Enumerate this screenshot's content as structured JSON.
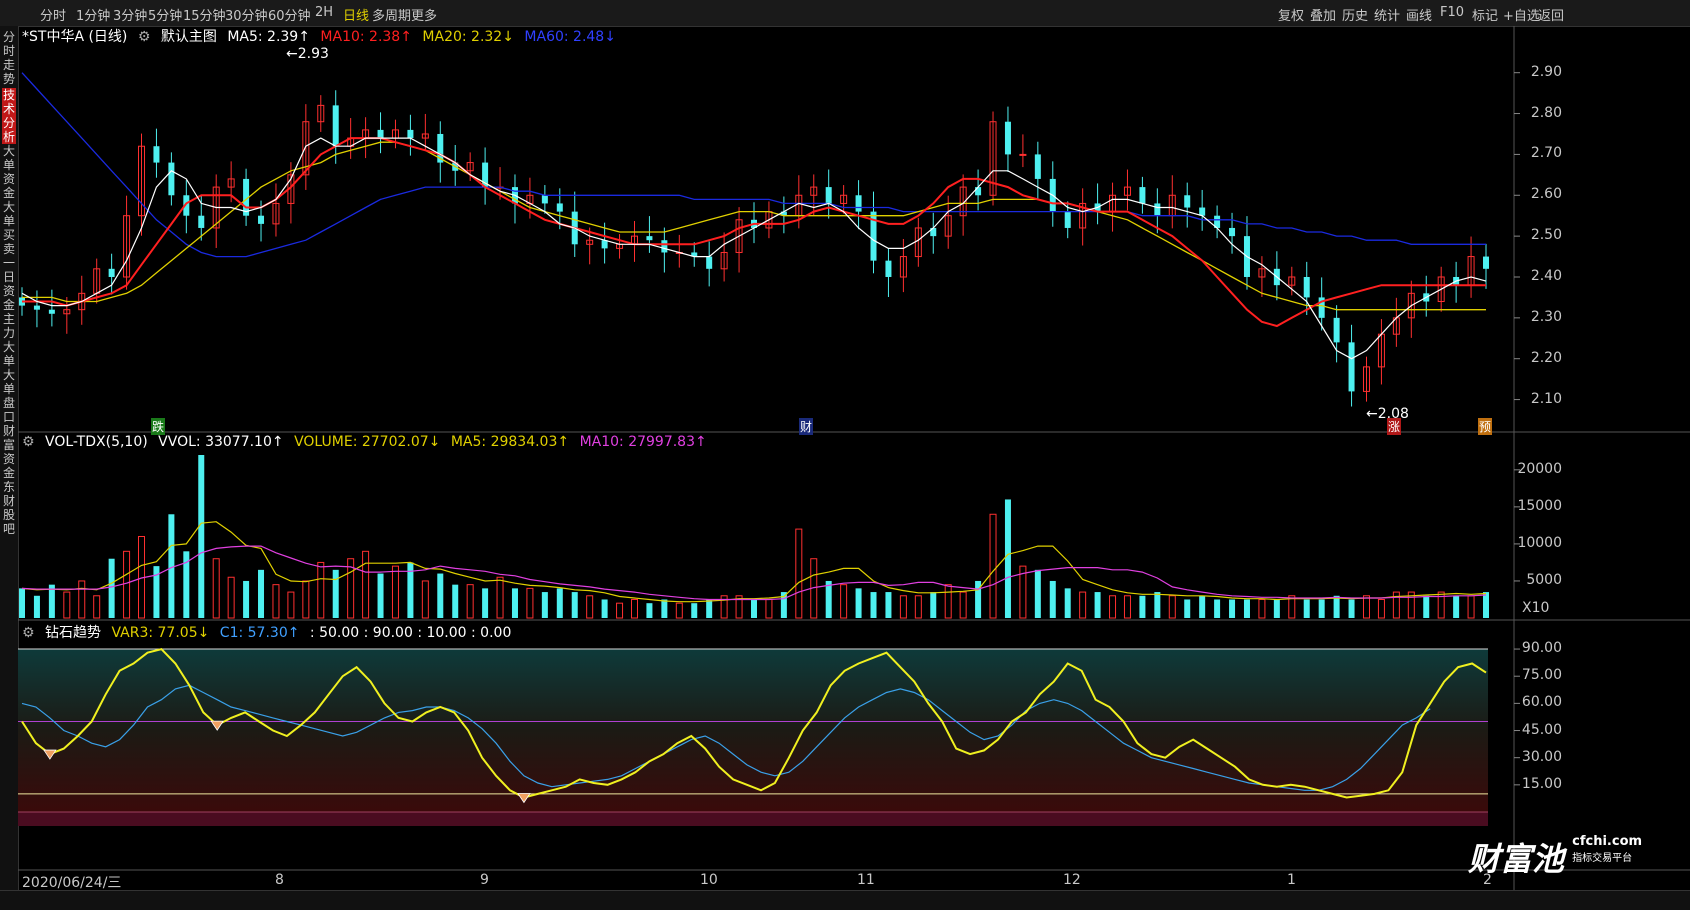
{
  "toolbar": {
    "left_tabs": [
      {
        "label": "分时",
        "active": false
      },
      {
        "label": "1分钟",
        "active": false
      },
      {
        "label": "3分钟",
        "active": false
      },
      {
        "label": "5分钟",
        "active": false
      },
      {
        "label": "15分钟",
        "active": false
      },
      {
        "label": "30分钟",
        "active": false
      },
      {
        "label": "60分钟",
        "active": false
      },
      {
        "label": "2H",
        "active": false
      },
      {
        "label": "日线",
        "active": true
      },
      {
        "label": "多周期",
        "active": false
      },
      {
        "label": "更多",
        "active": false
      }
    ],
    "right_tabs": [
      "复权",
      "叠加",
      "历史",
      "统计",
      "画线",
      "F10",
      "标记",
      "+自选",
      "返回"
    ]
  },
  "side_tabs": [
    {
      "label": "分时走势",
      "active": false
    },
    {
      "label": "技术分析",
      "active": true
    },
    {
      "label": "大单资金",
      "active": false
    },
    {
      "label": "大单买卖",
      "active": false
    },
    {
      "label": "一日资金",
      "active": false
    },
    {
      "label": "主力大单",
      "active": false
    },
    {
      "label": "大单盘口",
      "active": false
    },
    {
      "label": "财富资金",
      "active": false
    },
    {
      "label": "东财股吧",
      "active": false
    }
  ],
  "main_panel": {
    "title": "*ST中华A (日线)",
    "template": "默认主图",
    "ma5": "MA5: 2.39↑",
    "ma10": "MA10: 2.38↑",
    "ma20": "MA20: 2.32↓",
    "ma60": "MA60: 2.48↓",
    "high_label": "2.93",
    "low_label": "2.08",
    "markers": {
      "die": "跌",
      "cai": "财",
      "zhang": "涨",
      "yu": "预"
    },
    "colors": {
      "ma5": "#ffffff",
      "ma10": "#ff2020",
      "ma20": "#e0d000",
      "ma60": "#1a2adf",
      "up": "#ff3030",
      "down": "#4ef0f0"
    }
  },
  "vol_panel": {
    "title": "VOL-TDX(5,10)",
    "vvol": "VVOL: 33077.10↑",
    "volume": "VOLUME: 27702.07↓",
    "ma5": "MA5: 29834.03↑",
    "ma10": "MA10: 27997.83↑",
    "unit": "X10"
  },
  "diamond_panel": {
    "title": "钻石趋势",
    "var3": "VAR3: 77.05↓",
    "c1": "C1: 57.30↑",
    "levels": ": 50.00 : 90.00 : 10.00 : 0.00"
  },
  "watermark": {
    "brand": "财富池",
    "site": "cfchi.com",
    "tagline": "指标交易平台"
  },
  "chart_data": [
    {
      "type": "candlestick",
      "title": "*ST中华A (日线)",
      "ylim": [
        2.05,
        2.98
      ],
      "yticks": [
        "2.90",
        "2.80",
        "2.70",
        "2.60",
        "2.50",
        "2.40",
        "2.30",
        "2.20",
        "2.10"
      ],
      "x_labels": [
        "2020/06/24/三",
        "8",
        "9",
        "10",
        "11",
        "12",
        "1",
        "2"
      ],
      "close": [
        2.33,
        2.32,
        2.31,
        2.32,
        2.36,
        2.42,
        2.4,
        2.55,
        2.72,
        2.68,
        2.6,
        2.55,
        2.52,
        2.62,
        2.64,
        2.55,
        2.53,
        2.58,
        2.65,
        2.78,
        2.82,
        2.72,
        2.74,
        2.76,
        2.74,
        2.76,
        2.74,
        2.75,
        2.68,
        2.66,
        2.68,
        2.62,
        2.62,
        2.58,
        2.6,
        2.58,
        2.56,
        2.48,
        2.49,
        2.47,
        2.48,
        2.5,
        2.49,
        2.46,
        2.46,
        2.45,
        2.42,
        2.46,
        2.54,
        2.52,
        2.56,
        2.55,
        2.6,
        2.62,
        2.58,
        2.6,
        2.56,
        2.44,
        2.4,
        2.45,
        2.52,
        2.5,
        2.55,
        2.62,
        2.6,
        2.78,
        2.7,
        2.7,
        2.64,
        2.56,
        2.52,
        2.58,
        2.56,
        2.6,
        2.62,
        2.58,
        2.55,
        2.6,
        2.57,
        2.55,
        2.52,
        2.5,
        2.4,
        2.42,
        2.38,
        2.4,
        2.35,
        2.3,
        2.24,
        2.12,
        2.18,
        2.26,
        2.3,
        2.36,
        2.34,
        2.4,
        2.38,
        2.45,
        2.42
      ],
      "ma5": [
        2.36,
        2.34,
        2.33,
        2.33,
        2.34,
        2.36,
        2.38,
        2.44,
        2.52,
        2.62,
        2.66,
        2.64,
        2.58,
        2.57,
        2.57,
        2.56,
        2.57,
        2.59,
        2.64,
        2.72,
        2.74,
        2.72,
        2.72,
        2.74,
        2.74,
        2.74,
        2.74,
        2.72,
        2.7,
        2.68,
        2.65,
        2.63,
        2.61,
        2.6,
        2.58,
        2.56,
        2.53,
        2.52,
        2.5,
        2.49,
        2.48,
        2.48,
        2.48,
        2.47,
        2.46,
        2.45,
        2.45,
        2.48,
        2.5,
        2.52,
        2.54,
        2.56,
        2.58,
        2.57,
        2.58,
        2.56,
        2.52,
        2.49,
        2.47,
        2.47,
        2.49,
        2.52,
        2.56,
        2.58,
        2.62,
        2.66,
        2.66,
        2.64,
        2.62,
        2.6,
        2.57,
        2.56,
        2.57,
        2.59,
        2.59,
        2.58,
        2.57,
        2.57,
        2.56,
        2.55,
        2.52,
        2.48,
        2.45,
        2.43,
        2.4,
        2.37,
        2.34,
        2.28,
        2.22,
        2.2,
        2.22,
        2.26,
        2.3,
        2.33,
        2.35,
        2.37,
        2.39,
        2.4,
        2.39
      ],
      "ma10": [
        2.34,
        2.34,
        2.34,
        2.33,
        2.34,
        2.35,
        2.36,
        2.38,
        2.43,
        2.48,
        2.53,
        2.58,
        2.6,
        2.6,
        2.6,
        2.57,
        2.57,
        2.59,
        2.62,
        2.66,
        2.7,
        2.72,
        2.74,
        2.74,
        2.74,
        2.73,
        2.72,
        2.71,
        2.7,
        2.68,
        2.65,
        2.62,
        2.6,
        2.58,
        2.56,
        2.54,
        2.53,
        2.52,
        2.51,
        2.5,
        2.49,
        2.48,
        2.48,
        2.48,
        2.48,
        2.48,
        2.49,
        2.5,
        2.52,
        2.53,
        2.53,
        2.53,
        2.54,
        2.56,
        2.57,
        2.56,
        2.55,
        2.54,
        2.53,
        2.53,
        2.55,
        2.58,
        2.62,
        2.64,
        2.64,
        2.63,
        2.62,
        2.6,
        2.59,
        2.58,
        2.58,
        2.57,
        2.56,
        2.56,
        2.56,
        2.54,
        2.52,
        2.5,
        2.47,
        2.44,
        2.4,
        2.36,
        2.32,
        2.29,
        2.28,
        2.3,
        2.32,
        2.34,
        2.35,
        2.36,
        2.37,
        2.38,
        2.38,
        2.38,
        2.38,
        2.38,
        2.38,
        2.38,
        2.38
      ],
      "ma20": [
        2.35,
        2.35,
        2.35,
        2.34,
        2.34,
        2.34,
        2.35,
        2.36,
        2.38,
        2.41,
        2.44,
        2.47,
        2.5,
        2.53,
        2.56,
        2.59,
        2.62,
        2.64,
        2.66,
        2.67,
        2.68,
        2.7,
        2.71,
        2.72,
        2.73,
        2.73,
        2.72,
        2.71,
        2.69,
        2.67,
        2.65,
        2.63,
        2.61,
        2.59,
        2.57,
        2.56,
        2.55,
        2.54,
        2.53,
        2.52,
        2.51,
        2.51,
        2.51,
        2.51,
        2.52,
        2.53,
        2.54,
        2.55,
        2.56,
        2.56,
        2.56,
        2.55,
        2.55,
        2.55,
        2.55,
        2.55,
        2.55,
        2.55,
        2.55,
        2.55,
        2.56,
        2.57,
        2.58,
        2.58,
        2.58,
        2.59,
        2.59,
        2.59,
        2.59,
        2.58,
        2.58,
        2.57,
        2.56,
        2.55,
        2.54,
        2.52,
        2.5,
        2.48,
        2.46,
        2.44,
        2.42,
        2.4,
        2.38,
        2.36,
        2.35,
        2.34,
        2.33,
        2.33,
        2.32,
        2.32,
        2.32,
        2.32,
        2.32,
        2.32,
        2.32,
        2.32,
        2.32,
        2.32,
        2.32
      ],
      "ma60": [
        2.9,
        2.86,
        2.82,
        2.78,
        2.74,
        2.7,
        2.66,
        2.62,
        2.58,
        2.54,
        2.51,
        2.48,
        2.46,
        2.45,
        2.45,
        2.45,
        2.46,
        2.47,
        2.48,
        2.49,
        2.51,
        2.53,
        2.55,
        2.57,
        2.59,
        2.6,
        2.61,
        2.62,
        2.62,
        2.62,
        2.62,
        2.62,
        2.62,
        2.61,
        2.61,
        2.6,
        2.6,
        2.6,
        2.6,
        2.6,
        2.6,
        2.6,
        2.6,
        2.6,
        2.6,
        2.59,
        2.59,
        2.59,
        2.59,
        2.59,
        2.59,
        2.58,
        2.58,
        2.58,
        2.58,
        2.57,
        2.57,
        2.57,
        2.57,
        2.56,
        2.56,
        2.56,
        2.56,
        2.56,
        2.56,
        2.56,
        2.56,
        2.56,
        2.56,
        2.56,
        2.56,
        2.56,
        2.56,
        2.56,
        2.56,
        2.55,
        2.55,
        2.55,
        2.55,
        2.54,
        2.54,
        2.54,
        2.53,
        2.53,
        2.52,
        2.52,
        2.51,
        2.51,
        2.5,
        2.5,
        2.49,
        2.49,
        2.49,
        2.48,
        2.48,
        2.48,
        2.48,
        2.48,
        2.48
      ]
    },
    {
      "type": "bar",
      "title": "VOL-TDX(5,10)",
      "ylim": [
        0,
        22000
      ],
      "yticks": [
        "20000",
        "15000",
        "10000",
        "5000"
      ],
      "values": [
        4000,
        3000,
        4500,
        3500,
        5000,
        3000,
        8000,
        9000,
        11000,
        7000,
        14000,
        9000,
        22000,
        8000,
        5500,
        5000,
        6500,
        4500,
        3500,
        5000,
        7500,
        6500,
        8000,
        9000,
        6000,
        7000,
        7500,
        5000,
        6000,
        4500,
        4500,
        4000,
        5500,
        4000,
        4000,
        3500,
        4000,
        3500,
        3000,
        2500,
        2000,
        2500,
        2000,
        2500,
        2000,
        2000,
        2500,
        3000,
        3000,
        2500,
        2500,
        3500,
        12000,
        8000,
        5000,
        4500,
        4000,
        3500,
        3500,
        3000,
        3000,
        3500,
        4500,
        3500,
        5000,
        14000,
        16000,
        7000,
        6500,
        5000,
        4000,
        3500,
        3500,
        3000,
        3000,
        3000,
        3500,
        3000,
        2500,
        3000,
        2500,
        2500,
        2500,
        2500,
        2500,
        3000,
        2500,
        2500,
        3000,
        2500,
        3000,
        2500,
        3500,
        3500,
        3000,
        3500,
        3000,
        3000,
        3500
      ],
      "ma5": [
        4000,
        3800,
        3900,
        3800,
        4000,
        3800,
        4700,
        5900,
        7100,
        7600,
        9800,
        10000,
        12800,
        13000,
        11600,
        9800,
        9400,
        5900,
        5000,
        4900,
        5300,
        5200,
        6200,
        7400,
        7400,
        7400,
        7500,
        6700,
        6600,
        6000,
        5500,
        5000,
        5100,
        4700,
        4400,
        4300,
        4100,
        3800,
        3700,
        3400,
        2900,
        2700,
        2500,
        2300,
        2200,
        2200,
        2300,
        2400,
        2600,
        2600,
        2700,
        2900,
        4800,
        5800,
        6200,
        6700,
        6700,
        5000,
        4100,
        3700,
        3400,
        3400,
        3500,
        3600,
        3800,
        6300,
        8600,
        9100,
        9700,
        9700,
        7700,
        5200,
        4500,
        3800,
        3400,
        3200,
        3200,
        3100,
        3000,
        3000,
        2900,
        2700,
        2600,
        2600,
        2500,
        2600,
        2600,
        2600,
        2700,
        2600,
        2700,
        2700,
        2900,
        3000,
        3100,
        3200,
        3300,
        3200,
        3300
      ],
      "ma10": [
        4000,
        3900,
        3900,
        3900,
        3900,
        3900,
        4200,
        4700,
        5400,
        5800,
        6800,
        7500,
        8800,
        9400,
        9600,
        9700,
        9700,
        8800,
        8100,
        7400,
        6900,
        7000,
        6900,
        6200,
        6200,
        6300,
        6300,
        6500,
        7000,
        6700,
        6500,
        6300,
        5900,
        5700,
        5200,
        4900,
        4600,
        4400,
        4200,
        3900,
        3700,
        3500,
        3200,
        3000,
        2800,
        2600,
        2500,
        2500,
        2500,
        2500,
        2500,
        2600,
        3500,
        4100,
        4400,
        4700,
        4800,
        4800,
        4400,
        4500,
        4800,
        4800,
        4300,
        4100,
        3900,
        4500,
        5500,
        6000,
        6400,
        6600,
        6800,
        6800,
        6800,
        6500,
        6500,
        6200,
        5400,
        4200,
        3800,
        3500,
        3200,
        3000,
        2900,
        2800,
        2800,
        2700,
        2700,
        2700,
        2800,
        2700,
        2700,
        2700,
        2800,
        2800,
        2900,
        2900,
        3000,
        3000,
        3100
      ]
    },
    {
      "type": "line",
      "title": "钻石趋势",
      "ylim": [
        0,
        95
      ],
      "yticks": [
        "90.00",
        "75.00",
        "60.00",
        "45.00",
        "30.00",
        "15.00"
      ],
      "reference_lines": [
        90,
        50,
        10,
        0
      ],
      "var3": [
        50,
        38,
        32,
        35,
        42,
        50,
        65,
        78,
        82,
        88,
        90,
        82,
        70,
        55,
        48,
        52,
        55,
        50,
        45,
        42,
        48,
        55,
        65,
        75,
        80,
        72,
        60,
        52,
        50,
        55,
        58,
        55,
        45,
        30,
        20,
        12,
        8,
        10,
        12,
        14,
        18,
        16,
        15,
        18,
        22,
        28,
        32,
        38,
        42,
        35,
        25,
        18,
        15,
        12,
        16,
        30,
        45,
        55,
        70,
        78,
        82,
        85,
        88,
        80,
        72,
        60,
        50,
        35,
        32,
        34,
        40,
        50,
        55,
        65,
        72,
        82,
        78,
        62,
        58,
        50,
        38,
        32,
        30,
        36,
        40,
        35,
        30,
        25,
        18,
        15,
        14,
        15,
        14,
        12,
        10,
        8,
        9,
        10,
        12,
        22,
        48,
        60,
        72,
        80,
        82,
        77
      ],
      "c1": [
        60,
        58,
        52,
        45,
        42,
        38,
        36,
        40,
        48,
        58,
        62,
        68,
        70,
        66,
        62,
        58,
        56,
        54,
        52,
        50,
        48,
        46,
        44,
        42,
        44,
        48,
        52,
        55,
        56,
        58,
        58,
        56,
        52,
        46,
        38,
        28,
        20,
        16,
        14,
        15,
        16,
        17,
        18,
        20,
        24,
        28,
        32,
        36,
        40,
        42,
        38,
        32,
        26,
        22,
        20,
        22,
        28,
        36,
        44,
        52,
        58,
        62,
        66,
        68,
        66,
        62,
        56,
        50,
        44,
        40,
        42,
        48,
        56,
        60,
        62,
        60,
        56,
        50,
        44,
        38,
        34,
        30,
        28,
        26,
        24,
        22,
        20,
        18,
        16,
        15,
        14,
        13,
        12,
        12,
        14,
        18,
        24,
        32,
        40,
        48,
        52,
        57
      ]
    }
  ]
}
